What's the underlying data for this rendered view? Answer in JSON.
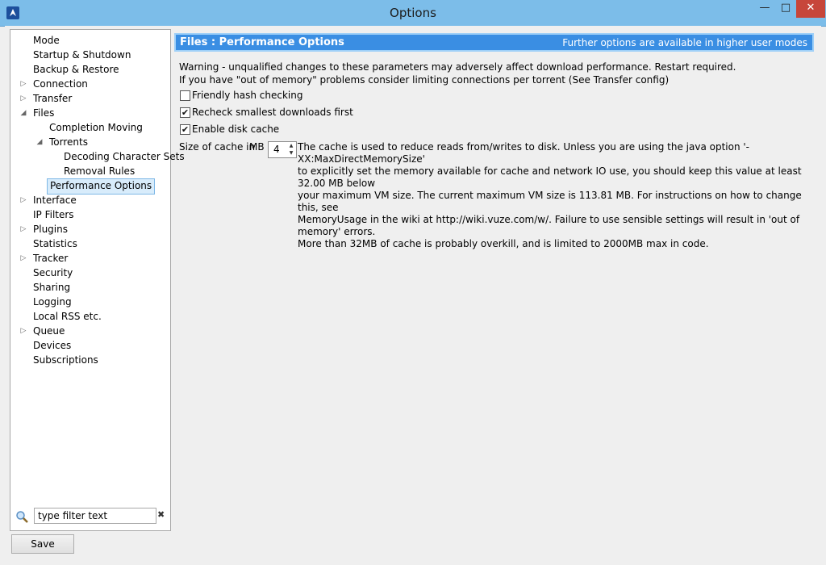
{
  "window": {
    "title": "Options",
    "min_icon": "—",
    "max_icon": "□",
    "close_icon": "✕"
  },
  "tree": {
    "items": [
      {
        "label": "Mode",
        "level": 0,
        "arrow": ""
      },
      {
        "label": "Startup & Shutdown",
        "level": 0,
        "arrow": ""
      },
      {
        "label": "Backup & Restore",
        "level": 0,
        "arrow": ""
      },
      {
        "label": "Connection",
        "level": 0,
        "arrow": "▷"
      },
      {
        "label": "Transfer",
        "level": 0,
        "arrow": "▷"
      },
      {
        "label": "Files",
        "level": 0,
        "arrow": "◢"
      },
      {
        "label": "Completion Moving",
        "level": 1,
        "arrow": ""
      },
      {
        "label": "Torrents",
        "level": 1,
        "arrow": "◢"
      },
      {
        "label": "Decoding Character Sets",
        "level": 2,
        "arrow": ""
      },
      {
        "label": "Removal Rules",
        "level": 2,
        "arrow": ""
      },
      {
        "label": "Performance Options",
        "level": 1,
        "arrow": "",
        "selected": true
      },
      {
        "label": "Interface",
        "level": 0,
        "arrow": "▷"
      },
      {
        "label": "IP Filters",
        "level": 0,
        "arrow": ""
      },
      {
        "label": "Plugins",
        "level": 0,
        "arrow": "▷"
      },
      {
        "label": "Statistics",
        "level": 0,
        "arrow": ""
      },
      {
        "label": "Tracker",
        "level": 0,
        "arrow": "▷"
      },
      {
        "label": "Security",
        "level": 0,
        "arrow": ""
      },
      {
        "label": "Sharing",
        "level": 0,
        "arrow": ""
      },
      {
        "label": "Logging",
        "level": 0,
        "arrow": ""
      },
      {
        "label": "Local RSS etc.",
        "level": 0,
        "arrow": ""
      },
      {
        "label": "Queue",
        "level": 0,
        "arrow": "▷"
      },
      {
        "label": "Devices",
        "level": 0,
        "arrow": ""
      },
      {
        "label": "Subscriptions",
        "level": 0,
        "arrow": ""
      }
    ]
  },
  "filter": {
    "value": "type filter text",
    "clear_icon": "✖"
  },
  "save_label": "Save",
  "header": {
    "title": "Files : Performance Options",
    "note": "Further options are available in higher user modes",
    "color": "#3a8ee3"
  },
  "content": {
    "warning_line1": "Warning - unqualified changes to these parameters may adversely affect download performance. Restart required.",
    "warning_line2": "If you have \"out of memory\" problems consider limiting connections per torrent (See Transfer config)",
    "checkboxes": [
      {
        "label": "Friendly hash checking",
        "checked": false
      },
      {
        "label": "Recheck smallest downloads first",
        "checked": true
      },
      {
        "label": "Enable disk cache",
        "checked": true
      }
    ],
    "cache_label": "Size of cache in",
    "cache_unit": "MB",
    "cache_value": "4",
    "cache_description": "The cache is used to reduce reads from/writes to disk. Unless you are using the java option '-XX:MaxDirectMemorySize'\nto explicitly set the memory available for cache and network IO use, you should keep this value at least 32.00 MB below\nyour maximum VM size. The current maximum VM size is 113.81 MB. For instructions on how to change this, see\nMemoryUsage in the wiki at http://wiki.vuze.com/w/. Failure to use sensible settings will result in 'out of memory' errors.\nMore than 32MB of cache is probably overkill, and is limited to 2000MB max in code."
  }
}
